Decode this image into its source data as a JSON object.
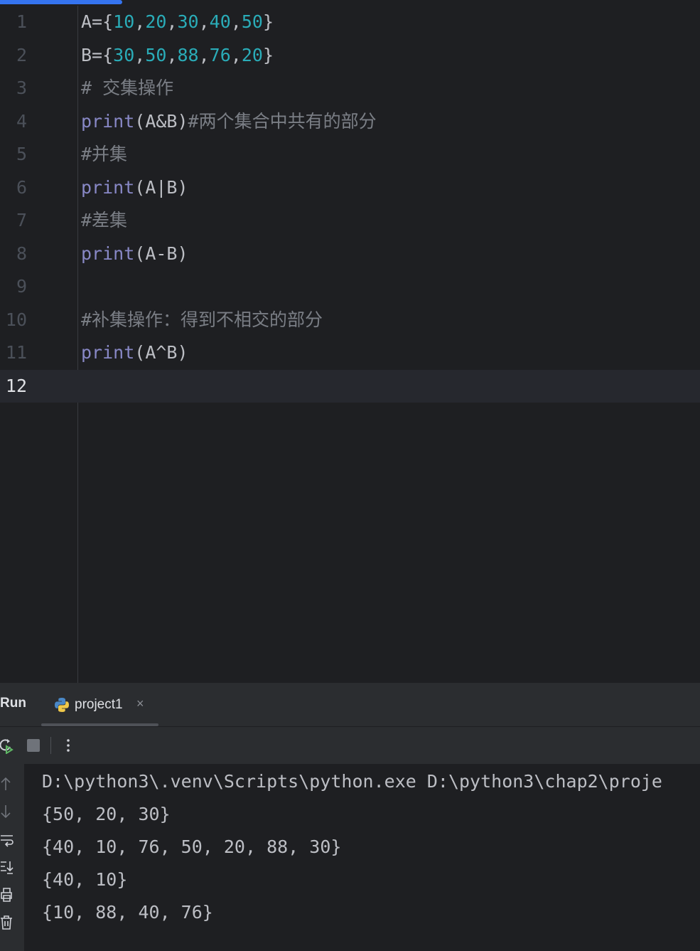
{
  "editor": {
    "lines": [
      {
        "n": "1"
      },
      {
        "n": "2"
      },
      {
        "n": "3"
      },
      {
        "n": "4"
      },
      {
        "n": "5"
      },
      {
        "n": "6"
      },
      {
        "n": "7"
      },
      {
        "n": "8"
      },
      {
        "n": "9"
      },
      {
        "n": "10"
      },
      {
        "n": "11"
      },
      {
        "n": "12"
      }
    ],
    "code": {
      "l1": {
        "a": "A={",
        "n1": "10",
        "c1": ",",
        "n2": "20",
        "c2": ",",
        "n3": "30",
        "c3": ",",
        "n4": "40",
        "c4": ",",
        "n5": "50",
        "b": "}"
      },
      "l2": {
        "a": "B={",
        "n1": "30",
        "c1": ",",
        "n2": "50",
        "c2": ",",
        "n3": "88",
        "c3": ",",
        "n4": "76",
        "c4": ",",
        "n5": "20",
        "b": "}"
      },
      "l3": {
        "comment": "# 交集操作"
      },
      "l4": {
        "kw": "print",
        "args": "(A&B)",
        "comment": "#两个集合中共有的部分"
      },
      "l5": {
        "comment": "#并集"
      },
      "l6": {
        "kw": "print",
        "args": "(A|B)"
      },
      "l7": {
        "comment": "#差集"
      },
      "l8": {
        "kw": "print",
        "args": "(A-B)"
      },
      "l10": {
        "comment": "#补集操作：得到不相交的部分"
      },
      "l11": {
        "kw": "print",
        "args": "(A^B)"
      }
    },
    "current_line": "12"
  },
  "run_panel": {
    "title": "Run",
    "tab_label": "project1",
    "tab_close": "×",
    "toolbar_more": "⋮"
  },
  "console": {
    "lines": [
      "D:\\python3\\.venv\\Scripts\\python.exe D:\\python3\\chap2\\proje",
      "{50, 20, 30}",
      "{40, 10, 76, 50, 20, 88, 30}",
      "{40, 10}",
      "{10, 88, 40, 76}"
    ]
  },
  "colors": {
    "background": "#1e1f22",
    "panel": "#2b2d30",
    "keyword": "#8888c6",
    "number": "#2aacb8",
    "comment": "#7a7e85",
    "text": "#bcbec4",
    "accent": "#3574f0"
  },
  "icons": {
    "tab": "python-file-icon",
    "rerun": "rerun-icon",
    "stop": "stop-icon",
    "side": [
      "scroll-up-icon",
      "scroll-down-icon",
      "soft-wrap-icon",
      "scroll-to-end-icon",
      "print-icon",
      "trash-icon"
    ]
  }
}
